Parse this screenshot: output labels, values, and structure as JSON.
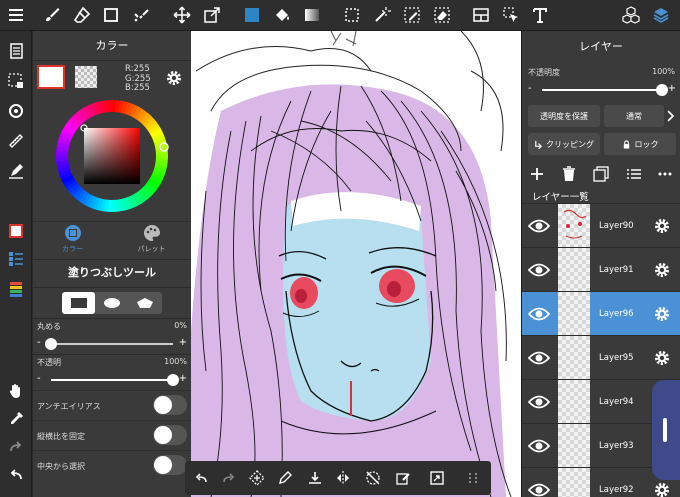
{
  "color_panel": {
    "title": "カラー",
    "rgb": {
      "r": "R:255",
      "g": "G:255",
      "b": "B:255"
    },
    "current_color": "#ffffff",
    "tabs": [
      {
        "label": "カラー",
        "icon": "color-circle-icon"
      },
      {
        "label": "パレット",
        "icon": "palette-icon"
      }
    ]
  },
  "tool_panel": {
    "title": "塗りつぶしツール",
    "shapes": [
      "rectangle-icon",
      "ellipse-icon",
      "polygon-icon"
    ],
    "roundness": {
      "label": "丸める",
      "value": "0%",
      "level": 0
    },
    "opacity": {
      "label": "不透明",
      "value": "100%",
      "level": 1.0
    },
    "toggles": [
      {
        "label": "アンチエイリアス",
        "on": false
      },
      {
        "label": "縦横比を固定",
        "on": false
      },
      {
        "label": "中央から選択",
        "on": false
      }
    ]
  },
  "layer_panel": {
    "title": "レイヤー",
    "opacity_label": "不透明度",
    "opacity_value": "100%",
    "opacity_level": 1.0,
    "protect_alpha": "透明度を保護",
    "blend_mode": "通常",
    "clipping": "クリッピング",
    "lock": "ロック",
    "list_header": "レイヤー一覧",
    "layers": [
      {
        "name": "Layer90",
        "selected": false
      },
      {
        "name": "Layer91",
        "selected": false
      },
      {
        "name": "Layer96",
        "selected": true
      },
      {
        "name": "Layer95",
        "selected": false
      },
      {
        "name": "Layer94",
        "selected": false
      },
      {
        "name": "Layer93",
        "selected": false
      },
      {
        "name": "Layer92",
        "selected": false
      }
    ]
  },
  "colors": {
    "accent_blue": "#4a91d6",
    "selected_color_border": "#e0322b",
    "sketch_purple": "#d9b8e8",
    "sketch_blue": "#b8dff0",
    "eye_red": "#e84a5f"
  }
}
